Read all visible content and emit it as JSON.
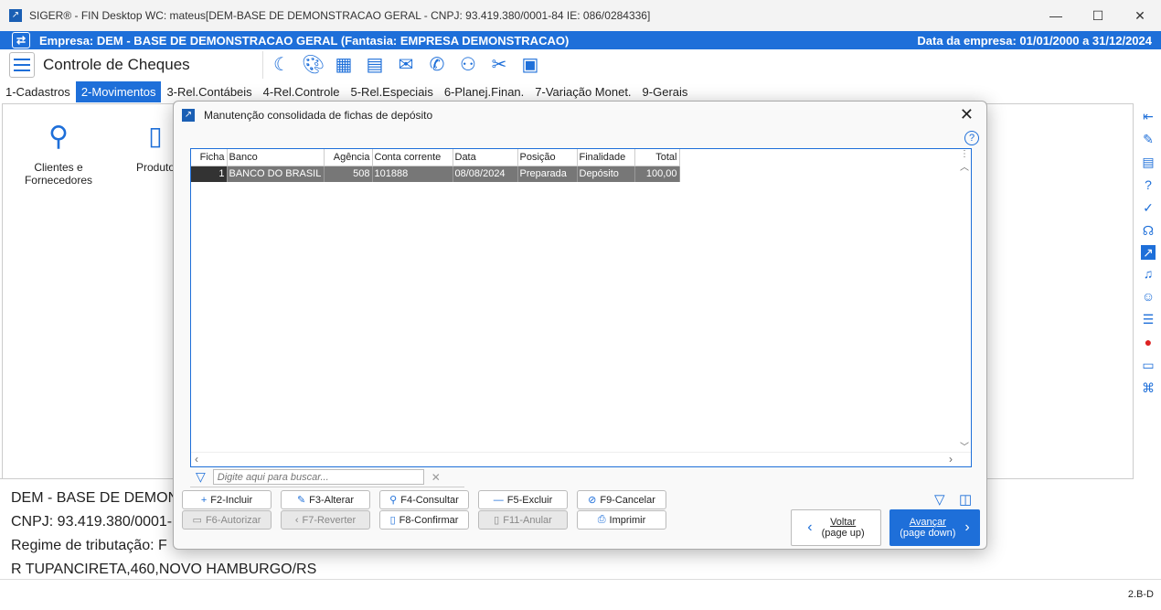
{
  "window": {
    "title": "SIGER® - FIN Desktop WC: mateus[DEM-BASE DE DEMONSTRACAO GERAL - CNPJ: 93.419.380/0001-84 IE: 086/0284336]",
    "minimize": "—",
    "maximize": "☐",
    "close": "✕"
  },
  "empresa": {
    "label": "Empresa: DEM - BASE DE DEMONSTRACAO GERAL (Fantasia: EMPRESA DEMONSTRACAO)",
    "date": "Data da empresa: 01/01/2000 a 31/12/2024"
  },
  "app": {
    "title": "Controle de Cheques"
  },
  "toolbar_icons": [
    "moon-icon",
    "palette-icon",
    "calculator-icon",
    "calendar-icon",
    "mail-icon",
    "phone-icon",
    "users-icon",
    "tools-icon",
    "briefcase-icon"
  ],
  "tabs": [
    "1-Cadastros",
    "2-Movimentos",
    "3-Rel.Contábeis",
    "4-Rel.Controle",
    "5-Rel.Especiais",
    "6-Planej.Finan.",
    "7-Variação Monet.",
    "9-Gerais"
  ],
  "shortcuts": [
    {
      "label": "Clientes e Fornecedores"
    },
    {
      "label": "Produto"
    }
  ],
  "info": {
    "line1": "DEM - BASE DE DEMON",
    "line2": "CNPJ: 93.419.380/0001-",
    "line3": "Regime de tributação: F",
    "line4": "R TUPANCIRETA,460,NOVO HAMBURGO/RS"
  },
  "status": {
    "version": "2.B-D"
  },
  "dialog": {
    "title": "Manutenção consolidada de fichas de depósito",
    "columns": [
      "Ficha",
      "Banco",
      "Agência",
      "Conta corrente",
      "Data",
      "Posição",
      "Finalidade",
      "Total"
    ],
    "rows": [
      [
        "1",
        "BANCO DO BRASIL",
        "508",
        "101888",
        "08/08/2024",
        "Preparada",
        "Depósito",
        "100,00"
      ]
    ],
    "search_placeholder": "Digite aqui para buscar...",
    "buttons": {
      "incluir": "F2-Incluir",
      "alterar": "F3-Alterar",
      "consultar": "F4-Consultar",
      "excluir": "F5-Excluir",
      "cancelar": "F9-Cancelar",
      "autorizar": "F6-Autorizar",
      "reverter": "F7-Reverter",
      "confirmar": "F8-Confirmar",
      "anular": "F11-Anular",
      "imprimir": "Imprimir"
    },
    "voltar": {
      "label": "Voltar",
      "sub": "(page up)"
    },
    "avancar": {
      "label": "Avançar",
      "sub": "(page down)"
    }
  },
  "colors": {
    "accent": "#1e6fd9"
  }
}
